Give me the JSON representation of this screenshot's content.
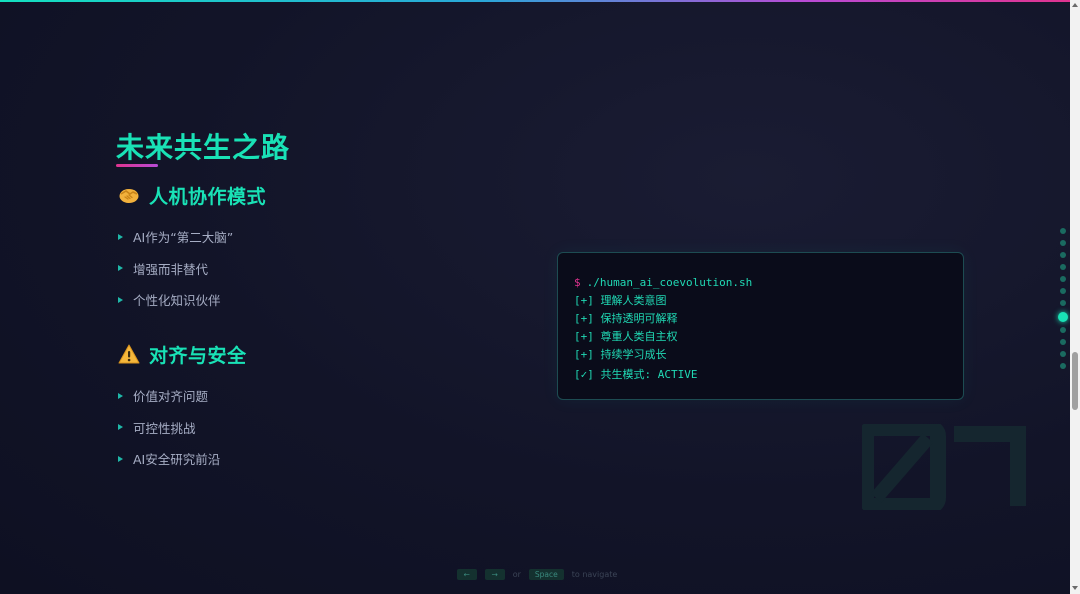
{
  "slide": {
    "title": "未来共生之路",
    "watermark_number": "07"
  },
  "sections": [
    {
      "icon": "handshake-icon",
      "heading": "人机协作模式",
      "items": [
        "AI作为“第二大脑”",
        "增强而非替代",
        "个性化知识伙伴"
      ]
    },
    {
      "icon": "warning-icon",
      "heading": "对齐与安全",
      "items": [
        "价值对齐问题",
        "可控性挑战",
        "AI安全研究前沿"
      ]
    }
  ],
  "terminal": {
    "prompt": "$",
    "command": "./human_ai_coevolution.sh",
    "lines": [
      "[+] 理解人类意图",
      "[+] 保持透明可解释",
      "[+] 尊重人类自主权",
      "[+] 持续学习成长"
    ],
    "result": "[✓] 共生模式: ACTIVE"
  },
  "navigation": {
    "dot_count": 12,
    "active_index": 7,
    "key_prev": "←",
    "key_next": "→",
    "or_text": "or",
    "key_space": "Space",
    "hint_text": "to navigate"
  },
  "colors": {
    "accent": "#19e2b6",
    "magenta": "#e0338f",
    "background": "#121428"
  }
}
